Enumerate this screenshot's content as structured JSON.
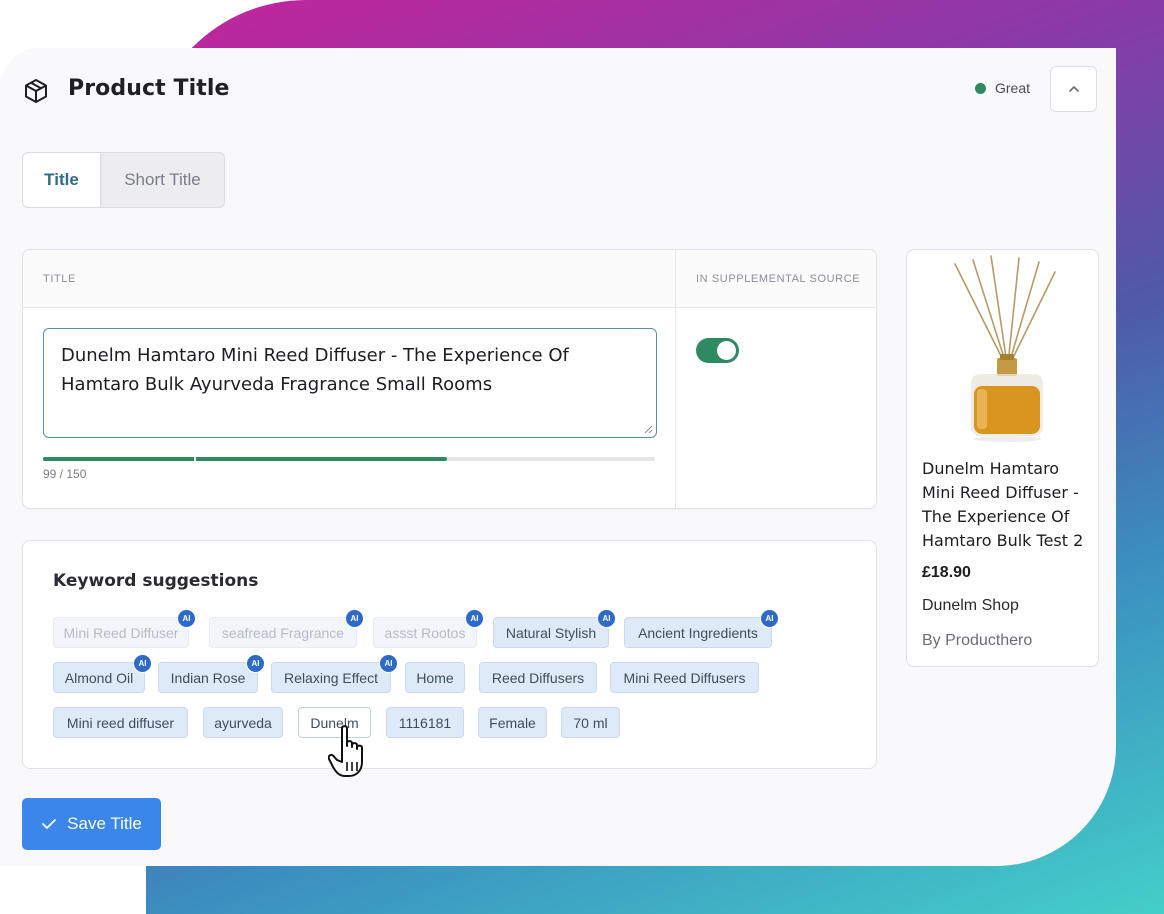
{
  "header": {
    "title": "Product Title",
    "status_label": "Great",
    "status_color": "#2f8a62",
    "cube_icon": "cube-icon",
    "collapse_icon": "chevron-up-icon"
  },
  "tabs": [
    {
      "label": "Title",
      "active": true
    },
    {
      "label": "Short Title",
      "active": false
    }
  ],
  "title_editor": {
    "column_title": "TITLE",
    "column_supplemental": "IN SUPPLEMENTAL SOURCE",
    "value": "Dunelm Hamtaro Mini Reed Diffuser - The Experience Of Hamtaro Bulk Ayurveda Fragrance Small Rooms",
    "char_count": "99 / 150",
    "progress_fraction": 0.66,
    "supplemental_enabled": true
  },
  "keywords": {
    "heading": "Keyword suggestions",
    "ai_badge_label": "AI",
    "chips": [
      {
        "label": "Mini Reed Diffuser",
        "ai": true,
        "state": "faded"
      },
      {
        "label": "seafread Fragrance",
        "ai": true,
        "state": "faded"
      },
      {
        "label": "assst Rootos",
        "ai": true,
        "state": "faded"
      },
      {
        "label": "Natural Stylish",
        "ai": true,
        "state": "normal"
      },
      {
        "label": "Ancient Ingredients",
        "ai": true,
        "state": "normal"
      },
      {
        "label": "Almond Oil",
        "ai": true,
        "state": "normal"
      },
      {
        "label": "Indian Rose",
        "ai": true,
        "state": "normal"
      },
      {
        "label": "Relaxing Effect",
        "ai": true,
        "state": "normal"
      },
      {
        "label": "Home",
        "ai": false,
        "state": "normal"
      },
      {
        "label": "Reed Diffusers",
        "ai": false,
        "state": "normal"
      },
      {
        "label": "Mini Reed Diffusers",
        "ai": false,
        "state": "normal"
      },
      {
        "label": "Mini reed diffuser",
        "ai": false,
        "state": "normal"
      },
      {
        "label": "ayurveda",
        "ai": false,
        "state": "normal"
      },
      {
        "label": "Dunelm",
        "ai": false,
        "state": "hovered"
      },
      {
        "label": "1116181",
        "ai": false,
        "state": "normal"
      },
      {
        "label": "Female",
        "ai": false,
        "state": "normal"
      },
      {
        "label": "70 ml",
        "ai": false,
        "state": "normal"
      }
    ]
  },
  "preview": {
    "name": "Dunelm Hamtaro Mini Reed Diffuser - The Experience Of Hamtaro Bulk Test 2",
    "price": "£18.90",
    "shop": "Dunelm Shop",
    "by": "By Producthero"
  },
  "save_button": {
    "label": "Save Title",
    "icon": "check-icon"
  }
}
